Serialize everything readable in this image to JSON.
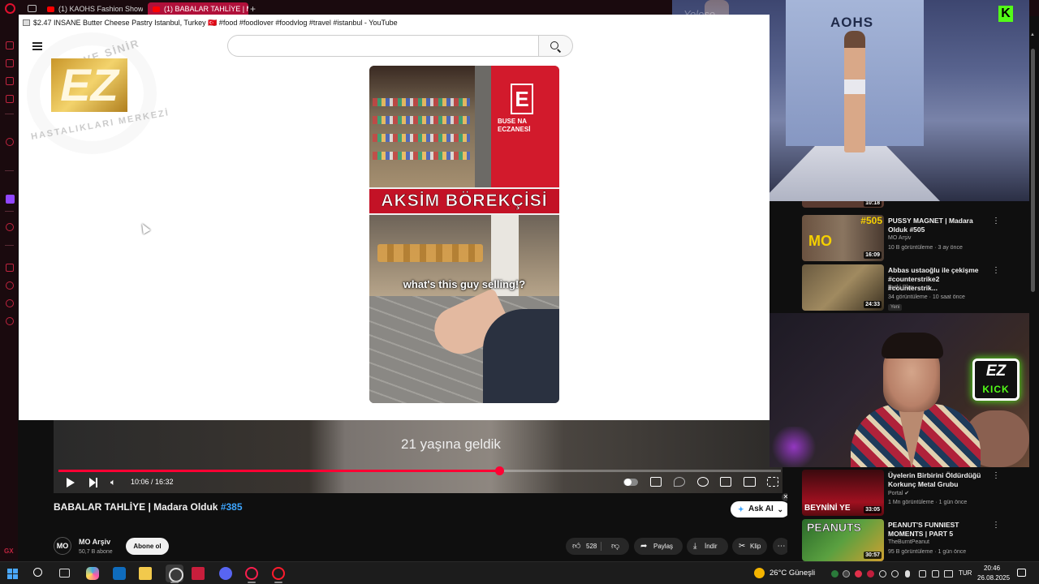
{
  "browser": {
    "tabs": [
      {
        "label": "(1) KAOHS Fashion Show"
      },
      {
        "label": "(1) BABALAR TAHLİYE | M"
      }
    ],
    "new_tab": "+"
  },
  "popup": {
    "window_title": "$2.47 INSANE Butter Cheese Pastry Istanbul, Turkey 🇹🇷 #food #foodlover #foodvlog #travel #istanbul - YouTube",
    "search_placeholder": "",
    "watermark": {
      "monogram": "EZ",
      "arc_top": "RUH VE SİNİR",
      "arc_bottom": "HASTALIKLARI MERKEZİ"
    },
    "short": {
      "shop_sign": "AKSİM BÖREKÇİSİ",
      "pharmacy_letter": "E",
      "pharmacy_name": "BUSE NA ECZANESİ",
      "caption": "what's this guy selling!?"
    }
  },
  "player": {
    "subtitle": "21 yaşına geldik",
    "time": "10:06 / 16:32",
    "progress": 0.61
  },
  "video": {
    "title": "BABALAR TAHLİYE | Madara Olduk",
    "hashtag": "#385",
    "ask_ai": "Ask AI",
    "channel": {
      "avatar_text": "MO",
      "name": "MO Arşiv",
      "subscribers": "50,7 B abone",
      "subscribe": "Abone ol"
    },
    "actions": {
      "likes": "528",
      "share": "Paylaş",
      "download": "İndir",
      "clip": "Klip",
      "more": "⋯"
    }
  },
  "overlay": {
    "runway_logo": "AOHS",
    "runway_watermark": "Yoloso..",
    "kick_letter": "K"
  },
  "recommendations": [
    {
      "title": "",
      "channel": "",
      "meta": "",
      "duration": "10:18"
    },
    {
      "title": "PUSSY MAGNET | Madara Olduk #505",
      "channel": "MO Arşiv",
      "meta": "10 B görüntüleme · 3 ay önce",
      "duration": "16:09",
      "thumb_text": "#505"
    },
    {
      "title": "Abbas ustaoğlu ile çekişme #counterstrike2 #counterstrik...",
      "channel": "Burki Play",
      "meta": "34 görüntüleme · 10 saat önce",
      "duration": "24:33",
      "badge": "Yeni"
    },
    {
      "title": "Üyelerin Birbirini Öldürdüğü Korkunç Metal Grubu",
      "channel": "Portal ✔",
      "meta": "1 Mn görüntüleme · 1 gün önce",
      "duration": "33:05",
      "thumb_text": "BEYNİNİ YE"
    },
    {
      "title": "PEANUT'S FUNNIEST MOMENTS | PART 5",
      "channel": "TheBurntPeanut",
      "meta": "95 B görüntüleme · 1 gün önce",
      "duration": "30:57",
      "thumb_text": "PEANUTS"
    }
  ],
  "webcam": {
    "logo_top": "EZ",
    "logo_bottom": "KICK"
  },
  "taskbar": {
    "weather": "26°C  Güneşli",
    "language": "TUR",
    "time": "20:46",
    "date": "26.08.2025"
  },
  "colors": {
    "youtube_red": "#ff0033",
    "opera_red": "#e0102e",
    "kick_green": "#53fc18",
    "link_blue": "#3ea6ff"
  }
}
